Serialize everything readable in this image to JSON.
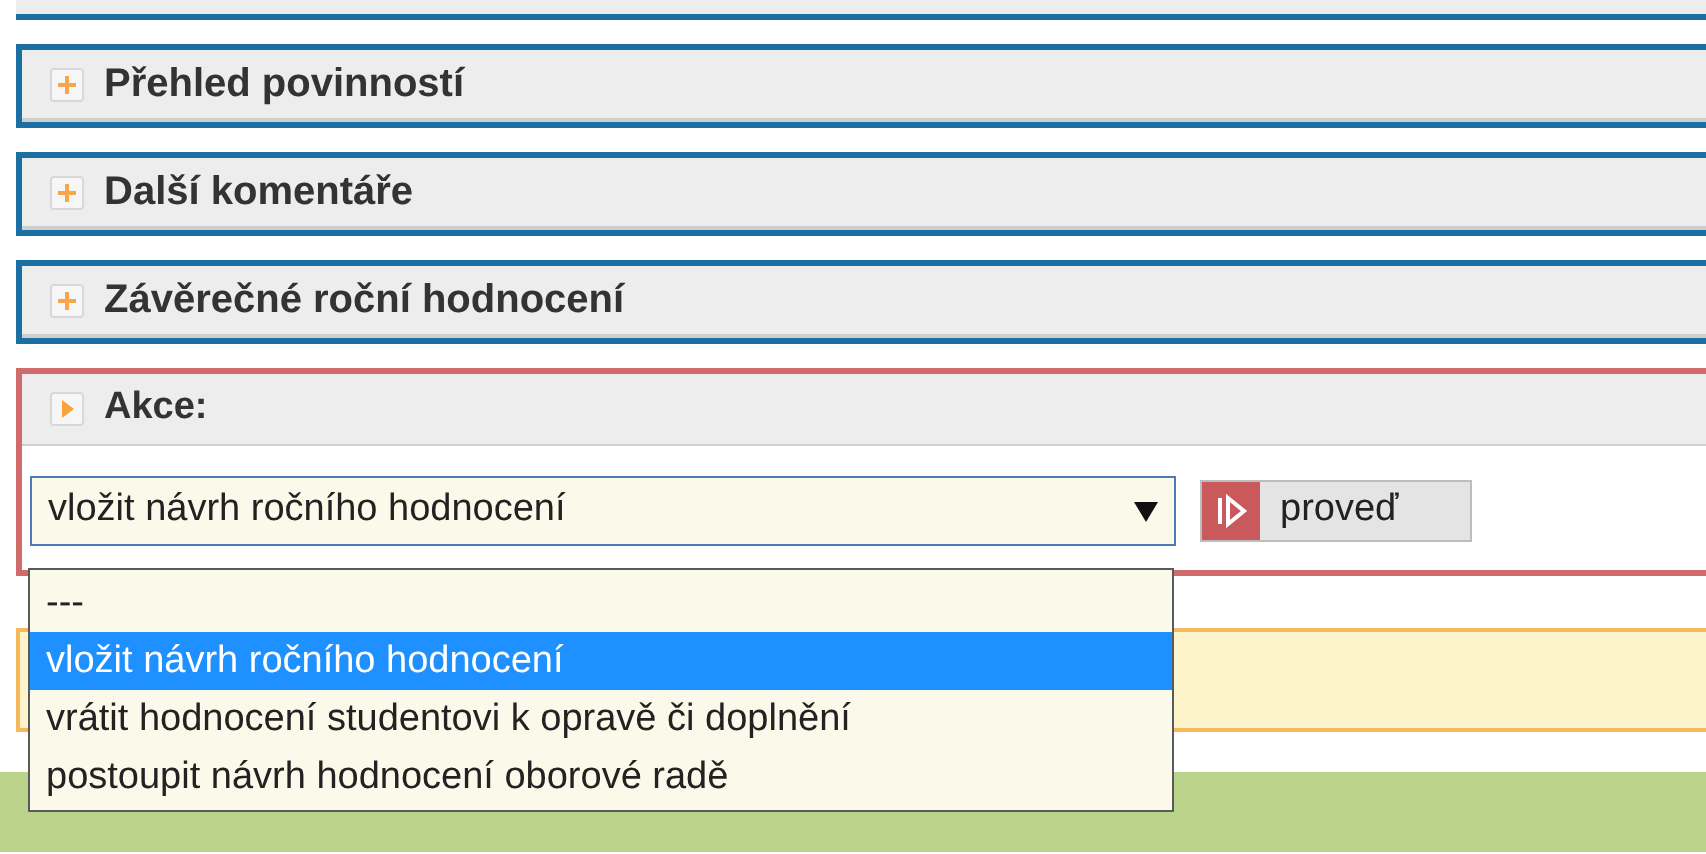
{
  "sections": [
    {
      "title": "Přehled povinností",
      "expanded": false
    },
    {
      "title": "Další komentáře",
      "expanded": false
    },
    {
      "title": "Závěrečné roční hodnocení",
      "expanded": false
    }
  ],
  "action_panel": {
    "title": "Akce:",
    "select": {
      "value": "vložit návrh ročního hodnocení",
      "open": true,
      "options": [
        {
          "label": "---",
          "selected": false
        },
        {
          "label": "vložit návrh ročního hodnocení",
          "selected": true
        },
        {
          "label": "vrátit hodnocení studentovi k opravě či doplnění",
          "selected": false
        },
        {
          "label": "postoupit návrh hodnocení oborové radě",
          "selected": false
        }
      ]
    },
    "button": "proveď"
  }
}
